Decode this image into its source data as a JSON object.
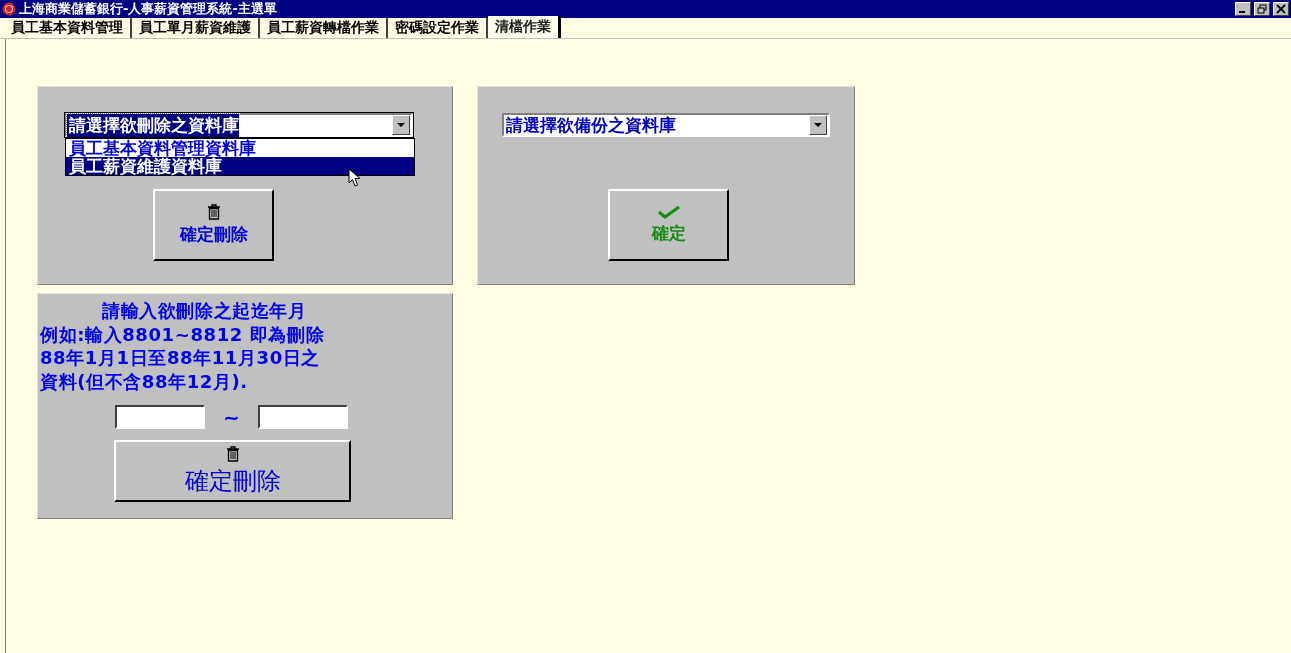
{
  "window": {
    "title": "上海商業儲蓄銀行-人事薪資管理系統-主選單"
  },
  "tabs": [
    {
      "label": "員工基本資料管理",
      "selected": false
    },
    {
      "label": "員工單月薪資維護",
      "selected": false
    },
    {
      "label": "員工薪資轉檔作業",
      "selected": false
    },
    {
      "label": "密碼設定作業",
      "selected": false
    },
    {
      "label": "清檔作業",
      "selected": true
    }
  ],
  "delete_panel": {
    "combo": {
      "value": "請選擇欲刪除之資料庫",
      "expanded": true,
      "options": [
        {
          "label": "員工基本資料管理資料庫",
          "selected": false
        },
        {
          "label": "員工薪資維護資料庫",
          "selected": true
        }
      ]
    },
    "button": {
      "label": "確定刪除"
    }
  },
  "backup_panel": {
    "combo": {
      "value": "請選擇欲備份之資料庫"
    },
    "button": {
      "label": "確定"
    }
  },
  "range_panel": {
    "instructions": [
      "請輸入欲刪除之起迄年月",
      "例如:輸入8801~8812 即為刪除",
      "88年1月1日至88年11月30日之",
      "資料(但不含88年12月)."
    ],
    "separator": "~",
    "button": {
      "label": "確定刪除"
    }
  }
}
